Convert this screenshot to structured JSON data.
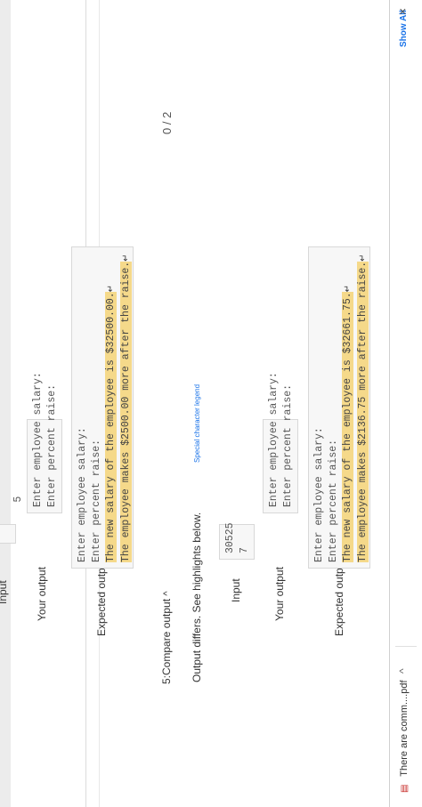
{
  "section4": {
    "input_label": "Input",
    "input_value": "5",
    "your_output_label": "Your output",
    "your_output_lines": [
      "Enter employee salary:",
      "Enter percent raise:"
    ],
    "expected_output_label": "Expected output",
    "expected_plain_lines": [
      "Enter employee salary:",
      "Enter percent raise:"
    ],
    "expected_highlight_lines": [
      "The new salary of the employee is $32500.00.",
      "The employee makes $2500.00 more after the raise."
    ]
  },
  "section5": {
    "title": "5:Compare output",
    "score": "0 / 2",
    "diff_message": "Output differs. See highlights below.",
    "legend_link": "Special character legend",
    "input_label": "Input",
    "input_lines": [
      "30525",
      "7"
    ],
    "your_output_label": "Your output",
    "your_output_lines": [
      "Enter employee salary:",
      "Enter percent raise:"
    ],
    "expected_output_label": "Expected output",
    "expected_plain_lines": [
      "Enter employee salary:",
      "Enter percent raise:"
    ],
    "expected_highlight_lines": [
      "The new salary of the employee is $32661.75.",
      "The employee makes $2136.75 more after the raise."
    ]
  },
  "downloads": {
    "file_name": "There are comm....pdf",
    "show_all": "Show All",
    "close": "×",
    "chevron": "^"
  },
  "colors": {
    "highlight": "#f5d98a",
    "link": "#1a73e8"
  }
}
